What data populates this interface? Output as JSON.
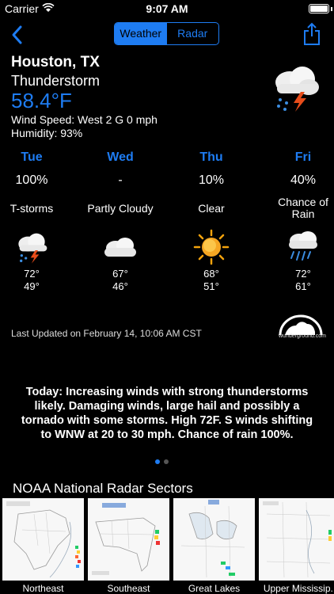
{
  "status": {
    "carrier": "Carrier",
    "time": "9:07 AM"
  },
  "nav": {
    "segments": [
      {
        "label": "Weather",
        "active": true
      },
      {
        "label": "Radar",
        "active": false
      }
    ]
  },
  "current": {
    "city": "Houston, TX",
    "condition": "Thunderstorm",
    "temperature": "58.4°F",
    "wind": "Wind Speed: West 2 G 0 mph",
    "humidity": "Humidity: 93%",
    "icon": "thunderstorm-icon"
  },
  "forecast": [
    {
      "day": "Tue",
      "precip": "100%",
      "condition": "T-storms",
      "icon": "thunderstorm-icon",
      "high": "72°",
      "low": "49°"
    },
    {
      "day": "Wed",
      "precip": "-",
      "condition": "Partly Cloudy",
      "icon": "cloud-icon",
      "high": "67°",
      "low": "46°"
    },
    {
      "day": "Thu",
      "precip": "10%",
      "condition": "Clear",
      "icon": "sun-icon",
      "high": "68°",
      "low": "51°"
    },
    {
      "day": "Fri",
      "precip": "40%",
      "condition": "Chance of Rain",
      "icon": "rain-icon",
      "high": "72°",
      "low": "61°"
    }
  ],
  "last_updated": "Last Updated on February 14, 10:06 AM CST",
  "wu_text": "wunderground.com",
  "summary": "Today: Increasing winds with strong thunderstorms likely. Damaging winds, large hail and possibly a tornado with some storms. High 72F. S winds shifting to WNW at 20 to 30 mph. Chance of rain 100%.",
  "pager": {
    "count": 2,
    "active": 0
  },
  "radar": {
    "title": "NOAA National Radar Sectors",
    "sectors": [
      {
        "label": "Northeast"
      },
      {
        "label": "Southeast"
      },
      {
        "label": "Great Lakes"
      },
      {
        "label": "Upper Mississip.."
      }
    ]
  },
  "colors": {
    "accent": "#1e7cf2",
    "background": "#000000"
  }
}
